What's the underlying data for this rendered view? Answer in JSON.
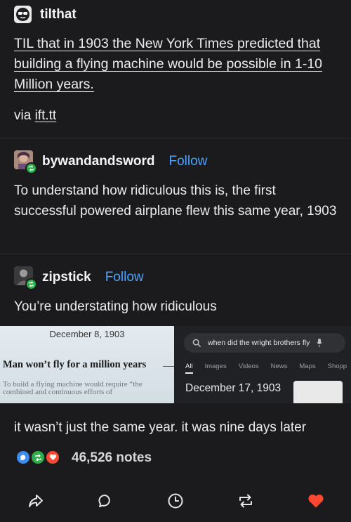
{
  "op": {
    "username": "tilthat",
    "title": "TIL that in 1903 the New York Times predicted that building a flying machine would be possible in 1-10 Million years.",
    "via_prefix": "via",
    "via_link": "ift.tt"
  },
  "reblog1": {
    "username": "bywandandsword",
    "follow": "Follow",
    "text": "To understand how ridiculous this is, the first successful powered airplane flew this same year, 1903"
  },
  "reblog2": {
    "username": "zipstick",
    "follow": "Follow",
    "text": "You’re understating how ridiculous",
    "caption": "it wasn’t just the same year. it was nine days later"
  },
  "newspaper": {
    "date": "December 8, 1903",
    "headline": "Man won’t fly for a million years",
    "body": "To build a flying machine would require “the combined and continuous efforts of"
  },
  "search": {
    "query": "when did the wright brothers fly",
    "tabs": [
      "All",
      "Images",
      "Videos",
      "News",
      "Maps",
      "Shopp"
    ],
    "result": "December 17, 1903"
  },
  "notes": {
    "count": "46,526 notes"
  },
  "colors": {
    "background": "#1b1b1d",
    "follow": "#4aa3ff",
    "reblog": "#2bb04a",
    "like": "#ff4930",
    "comment": "#3c8cf4"
  },
  "icons": [
    "share-icon",
    "comment-icon",
    "clock-icon",
    "reblog-icon",
    "heart-icon"
  ]
}
